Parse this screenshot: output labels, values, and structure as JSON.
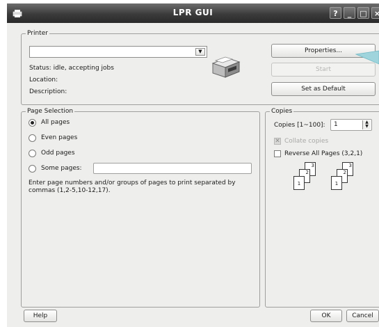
{
  "window": {
    "title": "LPR GUI",
    "help_btn": "?",
    "min_btn": "_",
    "max_btn": "□",
    "close_btn": "×"
  },
  "printer": {
    "legend": "Printer",
    "selected": "",
    "status": "Status: idle, accepting jobs",
    "location": "Location:",
    "description": "Description:",
    "properties_label": "Properties...",
    "start_label": "Start",
    "set_default_label": "Set as Default"
  },
  "page_selection": {
    "legend": "Page Selection",
    "options": [
      "All pages",
      "Even pages",
      "Odd pages",
      "Some pages:"
    ],
    "selected": "All pages",
    "some_pages_value": "",
    "hint": "Enter page numbers and/or groups of pages to print separated by commas (1,2-5,10-12,17)."
  },
  "copies": {
    "legend": "Copies",
    "label": "Copies [1~100]:",
    "value": "1",
    "collate_label": "Collate copies",
    "reverse_label": "Reverse All Pages (3,2,1)",
    "stack_pages": [
      "3",
      "2",
      "1"
    ]
  },
  "buttons": {
    "help": "Help",
    "ok": "OK",
    "cancel": "Cancel"
  },
  "colors": {
    "titlebar": "#3b3b3b",
    "window_bg": "#eeeeec",
    "callout": "#9fd4dc"
  }
}
